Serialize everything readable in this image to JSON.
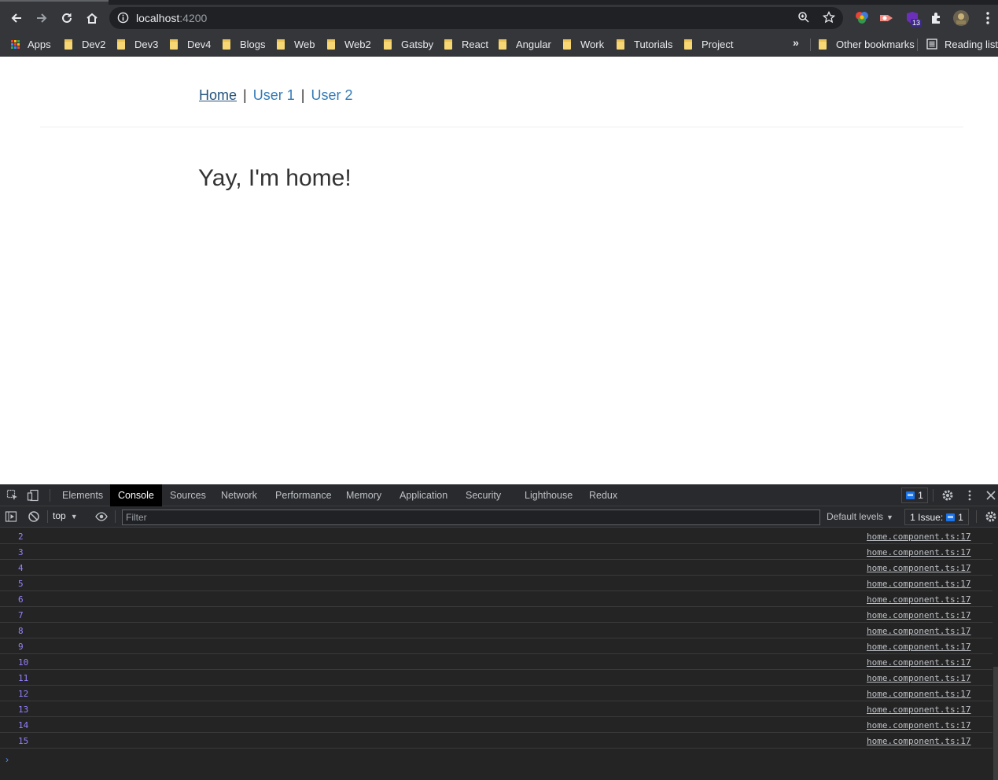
{
  "browser": {
    "url_host": "localhost",
    "url_port": ":4200",
    "extension_badge": "13",
    "bookmarks": [
      "Apps",
      "Dev2",
      "Dev3",
      "Dev4",
      "Blogs",
      "Web",
      "Web2",
      "Gatsby",
      "React",
      "Angular",
      "Work",
      "Tutorials",
      "Project"
    ],
    "overflow_label": "»",
    "other_bookmarks": "Other bookmarks",
    "reading_list": "Reading list"
  },
  "page": {
    "nav": {
      "home": "Home",
      "separator": "|",
      "user1": "User 1",
      "user2": "User 2"
    },
    "heading": "Yay, I'm home!"
  },
  "devtools": {
    "tabs": [
      "Elements",
      "Console",
      "Sources",
      "Network",
      "Performance",
      "Memory",
      "Application",
      "Security",
      "Lighthouse",
      "Redux"
    ],
    "active_tab": "Console",
    "message_count": "1",
    "context": "top",
    "filter_placeholder": "Filter",
    "levels": "Default levels",
    "issues_label": "1 Issue:",
    "issues_count": "1",
    "console_rows": [
      {
        "value": "2",
        "source": "home.component.ts:17"
      },
      {
        "value": "3",
        "source": "home.component.ts:17"
      },
      {
        "value": "4",
        "source": "home.component.ts:17"
      },
      {
        "value": "5",
        "source": "home.component.ts:17"
      },
      {
        "value": "6",
        "source": "home.component.ts:17"
      },
      {
        "value": "7",
        "source": "home.component.ts:17"
      },
      {
        "value": "8",
        "source": "home.component.ts:17"
      },
      {
        "value": "9",
        "source": "home.component.ts:17"
      },
      {
        "value": "10",
        "source": "home.component.ts:17"
      },
      {
        "value": "11",
        "source": "home.component.ts:17"
      },
      {
        "value": "12",
        "source": "home.component.ts:17"
      },
      {
        "value": "13",
        "source": "home.component.ts:17"
      },
      {
        "value": "14",
        "source": "home.component.ts:17"
      },
      {
        "value": "15",
        "source": "home.component.ts:17"
      }
    ],
    "prompt_symbol": "›"
  },
  "colors": {
    "link": "#337ab7",
    "console_value": "#9980ff",
    "issue_blue": "#1a73e8"
  }
}
